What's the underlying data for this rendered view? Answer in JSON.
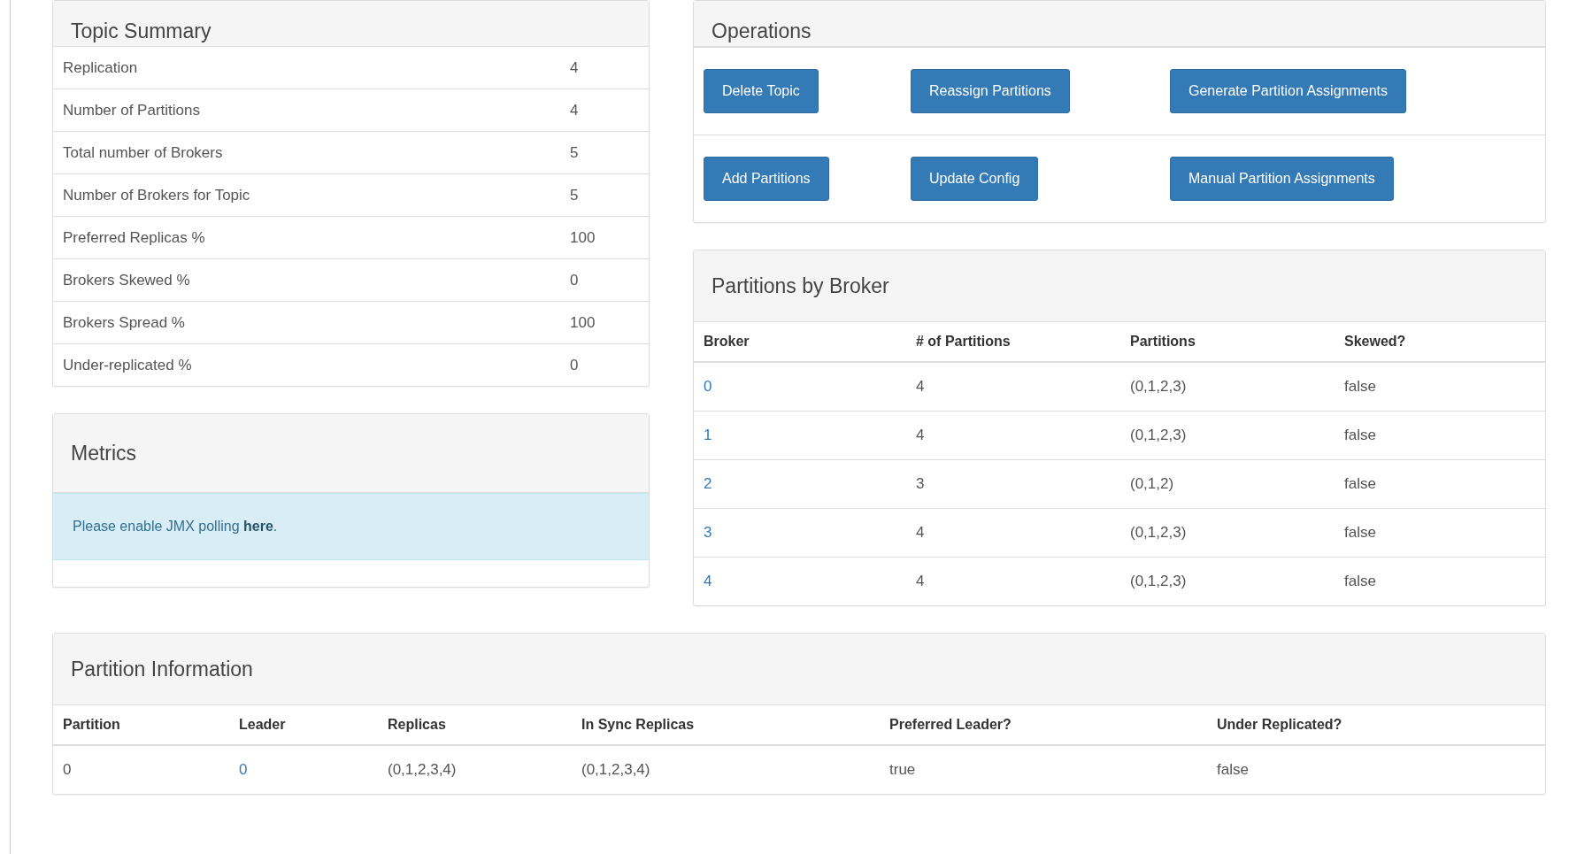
{
  "topic_summary": {
    "title": "Topic Summary",
    "rows": [
      {
        "label": "Replication",
        "value": "4"
      },
      {
        "label": "Number of Partitions",
        "value": "4"
      },
      {
        "label": "Total number of Brokers",
        "value": "5"
      },
      {
        "label": "Number of Brokers for Topic",
        "value": "5"
      },
      {
        "label": "Preferred Replicas %",
        "value": "100"
      },
      {
        "label": "Brokers Skewed %",
        "value": "0"
      },
      {
        "label": "Brokers Spread %",
        "value": "100"
      },
      {
        "label": "Under-replicated %",
        "value": "0"
      }
    ]
  },
  "metrics": {
    "title": "Metrics",
    "alert": {
      "text": "Please enable JMX polling",
      "link": "here",
      "end": "."
    }
  },
  "operations": {
    "title": "Operations",
    "rows": [
      [
        "Delete Topic",
        "Reassign Partitions",
        "Generate Partition Assignments"
      ],
      [
        "Add Partitions",
        "Update Config",
        "Manual Partition Assignments"
      ]
    ]
  },
  "partitions_by_broker": {
    "title": "Partitions by Broker",
    "columns": [
      {
        "label": "Broker",
        "kind": "link"
      },
      {
        "label": "# of Partitions",
        "kind": "text"
      },
      {
        "label": "Partitions",
        "kind": "text"
      },
      {
        "label": "Skewed?",
        "kind": "text"
      }
    ],
    "rows": [
      [
        "0",
        "4",
        "(0,1,2,3)",
        "false"
      ],
      [
        "1",
        "4",
        "(0,1,2,3)",
        "false"
      ],
      [
        "2",
        "3",
        "(0,1,2)",
        "false"
      ],
      [
        "3",
        "4",
        "(0,1,2,3)",
        "false"
      ],
      [
        "4",
        "4",
        "(0,1,2,3)",
        "false"
      ]
    ]
  },
  "partition_information": {
    "title": "Partition Information",
    "columns": [
      {
        "label": "Partition",
        "kind": "text"
      },
      {
        "label": "Leader",
        "kind": "link"
      },
      {
        "label": "Replicas",
        "kind": "text"
      },
      {
        "label": "In Sync Replicas",
        "kind": "text"
      },
      {
        "label": "Preferred Leader?",
        "kind": "text"
      },
      {
        "label": "Under Replicated?",
        "kind": "text"
      }
    ],
    "rows": [
      [
        "0",
        "0",
        "(0,1,2,3,4)",
        "(0,1,2,3,4)",
        "true",
        "false"
      ]
    ]
  }
}
